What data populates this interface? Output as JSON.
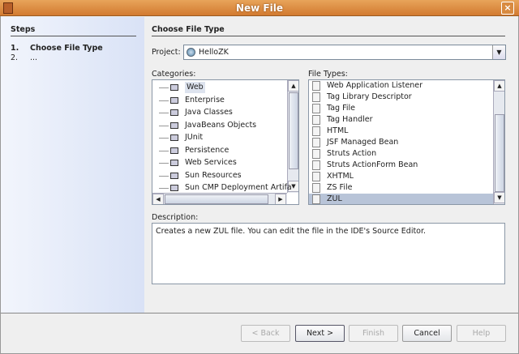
{
  "window": {
    "title": "New File"
  },
  "steps": {
    "heading": "Steps",
    "items": [
      {
        "num": "1.",
        "label": "Choose File Type"
      },
      {
        "num": "2.",
        "label": "..."
      }
    ]
  },
  "main": {
    "heading": "Choose File Type",
    "project_label": "Project:",
    "project_value": "HelloZK",
    "categories_label": "Categories:",
    "file_types_label": "File Types:",
    "description_label": "Description:",
    "description": "Creates a new ZUL file. You can edit the file in the IDE's Source Editor."
  },
  "categories": [
    "Web",
    "Enterprise",
    "Java Classes",
    "JavaBeans Objects",
    "JUnit",
    "Persistence",
    "Web Services",
    "Sun Resources",
    "Sun CMP Deployment Artifa"
  ],
  "file_types": [
    "Web Application Listener",
    "Tag Library Descriptor",
    "Tag File",
    "Tag Handler",
    "HTML",
    "JSF Managed Bean",
    "Struts Action",
    "Struts ActionForm Bean",
    "XHTML",
    "ZS File",
    "ZUL"
  ],
  "buttons": {
    "back": "< Back",
    "next": "Next >",
    "finish": "Finish",
    "cancel": "Cancel",
    "help": "Help"
  }
}
